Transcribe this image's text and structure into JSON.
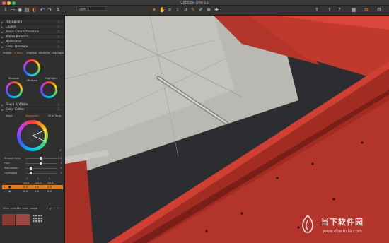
{
  "window": {
    "title": "Capture One 12"
  },
  "toolbar": {
    "left_icons": [
      "import-icon",
      "folder-icon",
      "capture-icon",
      "library-icon",
      "adjust-icon",
      "undo-icon",
      "redo-icon",
      "text-icon"
    ],
    "center_icons": [
      "cursor-icon",
      "pan-icon",
      "crop-icon",
      "straighten-icon",
      "keystone-icon",
      "brush-icon",
      "picker-icon",
      "clone-icon",
      "heal-icon"
    ],
    "right_icons": [
      "export-icon",
      "share-icon",
      "help-icon",
      "grid-icon",
      "copy-icon",
      "settings-icon"
    ],
    "layer_label": "Layer 1"
  },
  "panel": {
    "sections": {
      "histogram": "Histogram",
      "layers": "Layers",
      "basic": "Basic Characteristics",
      "white_balance": "White Balance",
      "normalize": "Normalize",
      "color_balance": "Color Balance",
      "bw": "Black & White",
      "color_editor": "Color Editor"
    },
    "cb_tabs": [
      "Master",
      "3-Way",
      "Shadow",
      "Midtone",
      "Highlight"
    ],
    "wheel_labels": {
      "shadow": "Shadow",
      "midtone": "Midtone",
      "highlight": "Highlight"
    },
    "ce_tabs": [
      "Basic",
      "Advanced",
      "Skin Tone"
    ],
    "sliders": [
      {
        "label": "Smoothness",
        "value": "2.1"
      },
      {
        "label": "Hue",
        "value": "0"
      },
      {
        "label": "Saturation",
        "value": "0"
      },
      {
        "label": "Lightness",
        "value": "0"
      }
    ],
    "table": {
      "headers": [
        "",
        "",
        "H",
        "S",
        "L"
      ],
      "rows": [
        [
          "",
          "",
          "14.1",
          "-23.0",
          "10.0"
        ],
        [
          "",
          "",
          "0.0",
          "0.0",
          "0.0"
        ],
        [
          "",
          "",
          "0.0",
          "0.0",
          "0.0"
        ]
      ]
    },
    "view_range": "View selected color range",
    "accent": "#e37c1f"
  },
  "watermark": {
    "name": "当下软件园",
    "url": "www.downxia.com"
  }
}
